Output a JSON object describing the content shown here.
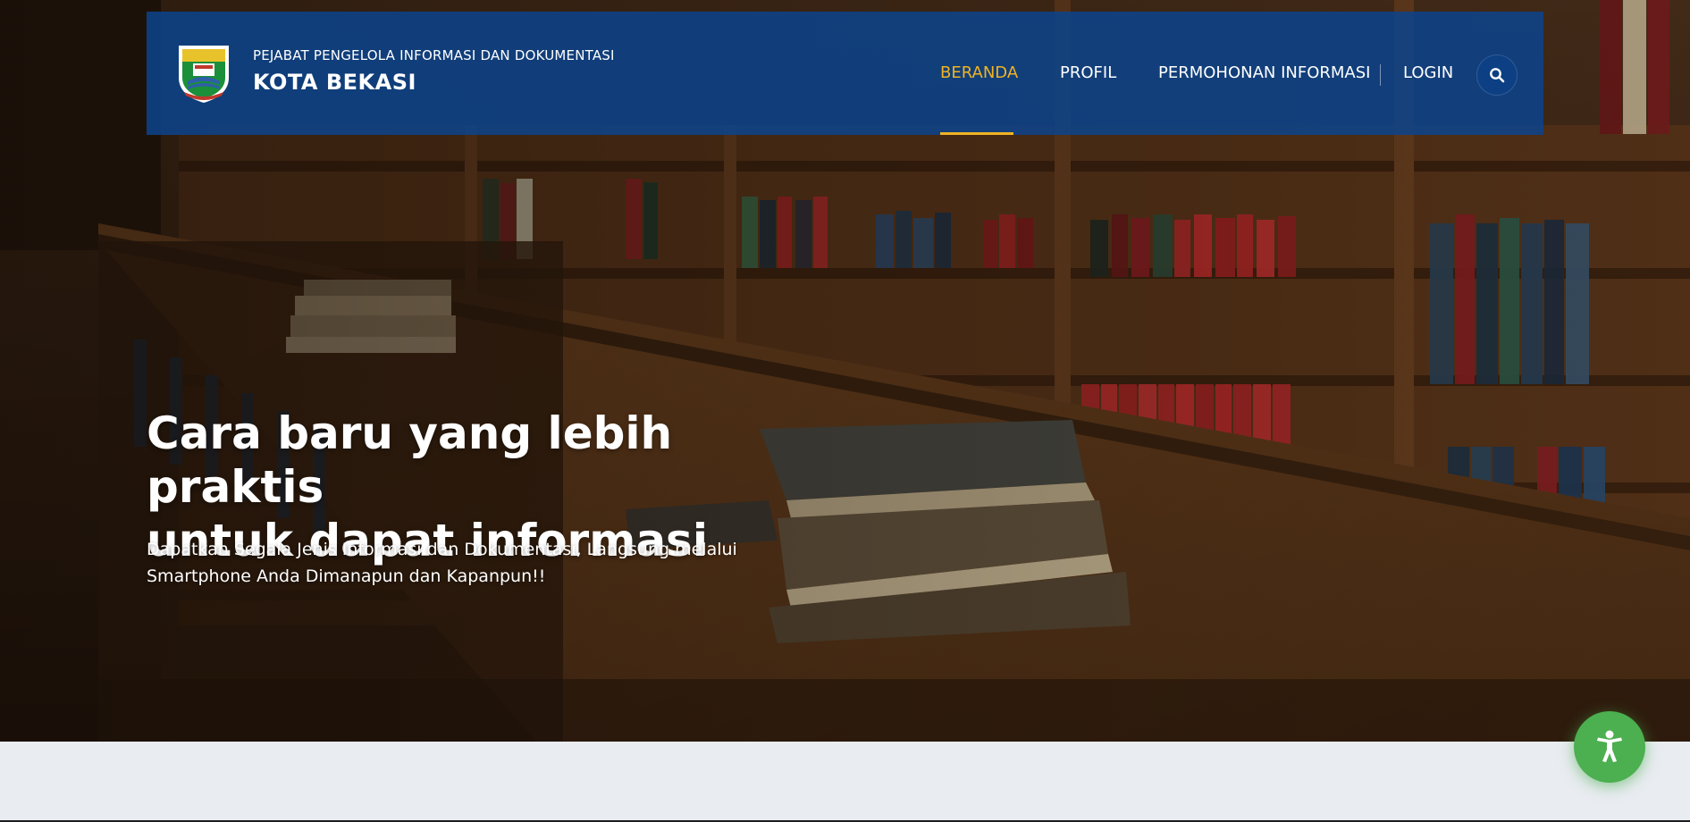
{
  "brand": {
    "subtitle": "PEJABAT PENGELOLA INFORMASI DAN DOKUMENTASI",
    "title": "KOTA BEKASI"
  },
  "nav": {
    "items": [
      {
        "label": "BERANDA",
        "active": true
      },
      {
        "label": "PROFIL",
        "active": false
      },
      {
        "label": "PERMOHONAN INFORMASI",
        "active": false
      },
      {
        "label": "LOGIN",
        "active": false
      }
    ]
  },
  "hero": {
    "title": "Cara baru yang lebih praktis\nuntuk dapat informasi",
    "description": "Dapatkan Segala Jenis Informasi dan Dokumentasi, Langsung melalui Smartphone Anda Dimanapun dan Kapanpun!!"
  },
  "icons": {
    "search": "search-icon",
    "accessibility": "accessibility-icon",
    "logo": "kota-bekasi-emblem"
  },
  "colors": {
    "navbar": "#0c448c",
    "active_nav": "#f0b323",
    "accessibility_button": "#4caf50",
    "page_background": "#e9ecf1"
  }
}
